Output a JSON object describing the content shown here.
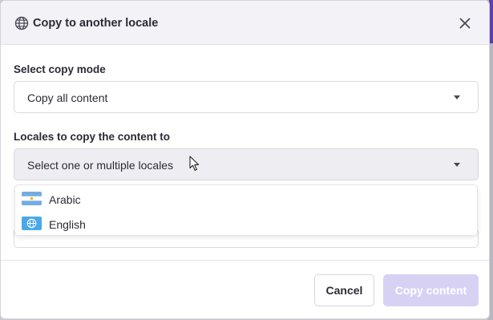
{
  "modal": {
    "title": "Copy to another locale",
    "icon": "globe-icon",
    "close_icon": "close-icon"
  },
  "copy_mode": {
    "label": "Select copy mode",
    "value": "Copy all content"
  },
  "locales": {
    "label": "Locales to copy the content to",
    "placeholder": "Select one or multiple locales",
    "options": [
      {
        "label": "Arabic",
        "icon": "argentina-flag-icon"
      },
      {
        "label": "English",
        "icon": "globe-icon"
      }
    ]
  },
  "footer": {
    "cancel_label": "Cancel",
    "submit_label": "Copy content"
  },
  "colors": {
    "primary_disabled": "#d7d2f4",
    "accent": "#5b3fb0"
  }
}
